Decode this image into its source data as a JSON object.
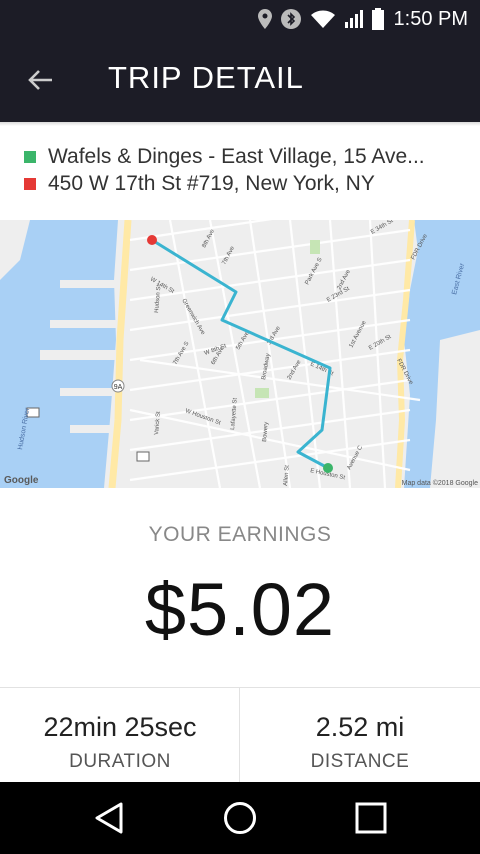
{
  "status_bar": {
    "time": "1:50 PM",
    "icons": [
      "location-icon",
      "bluetooth-icon",
      "wifi-icon",
      "signal-icon",
      "battery-icon"
    ]
  },
  "header": {
    "title": "TRIP DETAIL",
    "back_icon": "back-arrow-icon"
  },
  "trip": {
    "pickup": {
      "address": "Wafels & Dinges - East Village, 15 Ave...",
      "color": "#3bb56a"
    },
    "dropoff": {
      "address": "450 W 17th St #719, New York, NY",
      "color": "#e53935"
    }
  },
  "map": {
    "route_color": "#3ab4d0",
    "streets": {
      "s1": "E 34th St",
      "s2": "E 23rd St",
      "s3": "E 20th St",
      "s4": "E 14th St",
      "s5": "W 14th St",
      "s6": "W 8th St",
      "s7": "W Houston St",
      "s8": "E Houston St",
      "a1": "8th Ave",
      "a2": "7th Ave",
      "a3": "Park Ave S",
      "a4": "2nd Ave",
      "a5": "1st Avenue",
      "a6": "Avenue C",
      "a7": "FDR Drive",
      "a8": "Broadway",
      "a9": "Greenwich Ave",
      "a10": "Hudson St",
      "a11": "Varick St",
      "a12": "Lafayette St",
      "a13": "Bowery",
      "a14": "Allen St",
      "a15": "6th Ave",
      "a16": "5th Ave",
      "a17": "7th Ave S",
      "a18": "3rd Ave",
      "a19": "2nd Ave",
      "a20": "9A"
    },
    "water": {
      "hudson": "Hudson River",
      "east": "East River"
    },
    "google_logo": "Google",
    "attribution": "Map data ©2018 Google"
  },
  "earnings": {
    "label": "YOUR EARNINGS",
    "amount": "$5.02"
  },
  "stats": {
    "duration": {
      "value": "22min 25sec",
      "label": "DURATION"
    },
    "distance": {
      "value": "2.52 mi",
      "label": "DISTANCE"
    }
  },
  "nav": {
    "back": "nav-back-icon",
    "home": "nav-home-icon",
    "recents": "nav-recents-icon"
  }
}
